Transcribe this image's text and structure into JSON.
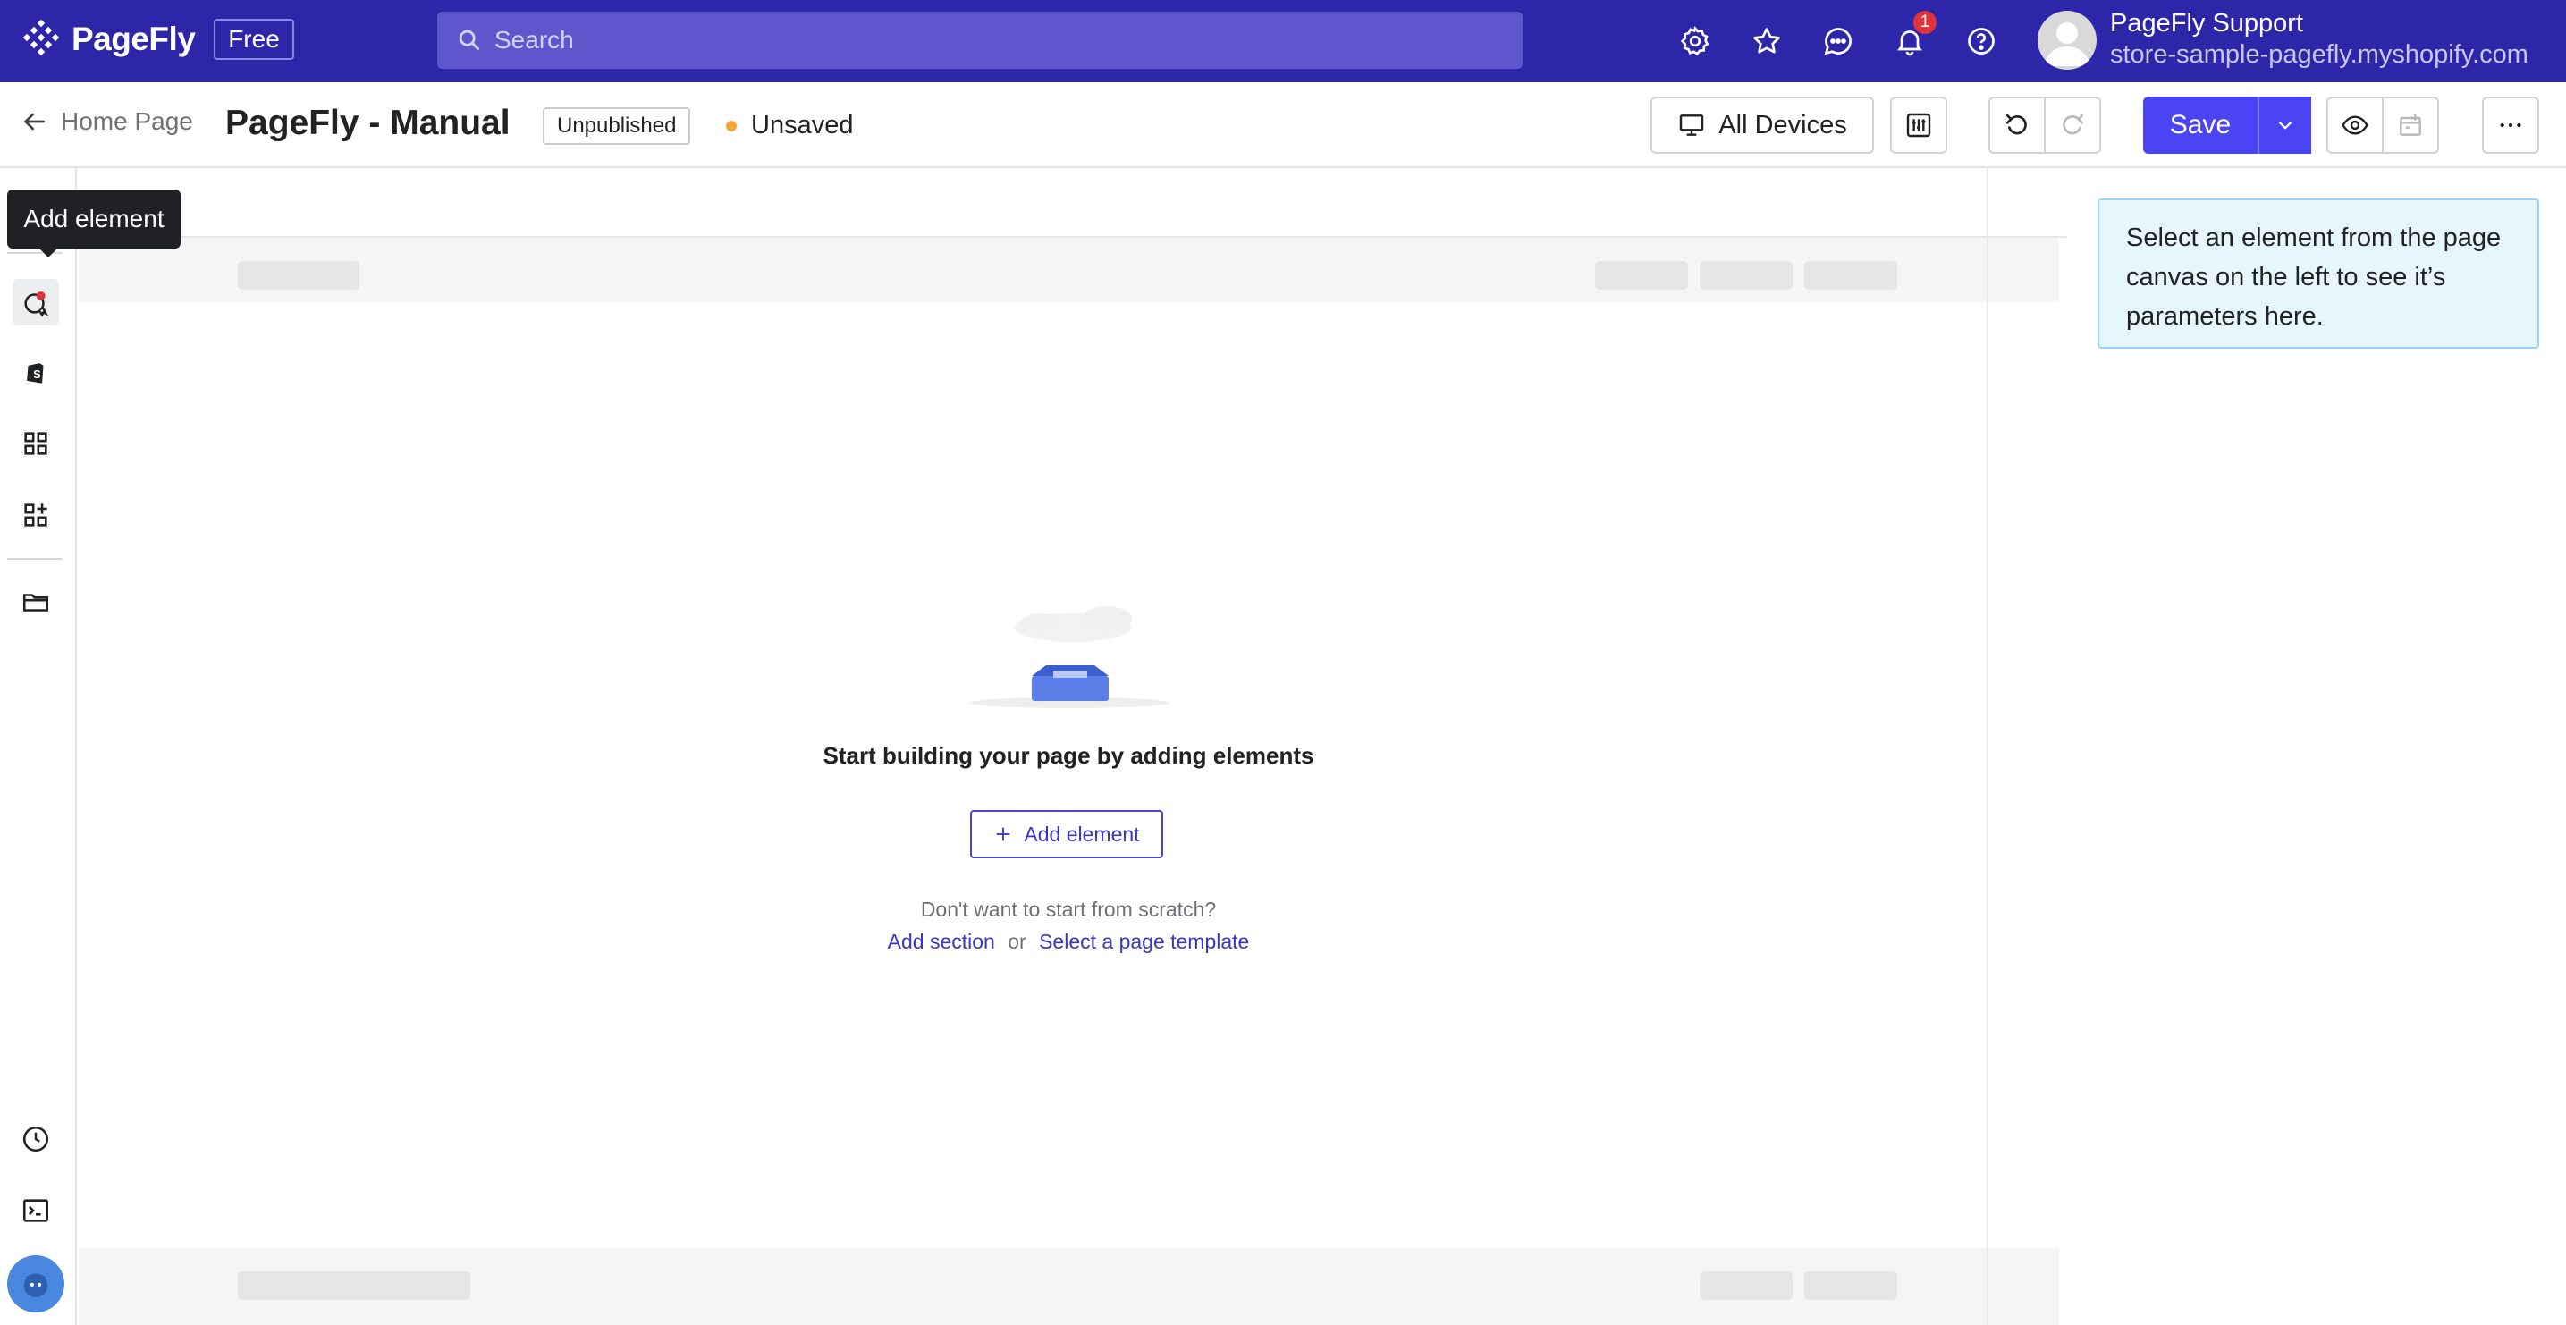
{
  "app": {
    "name": "PageFly",
    "plan": "Free"
  },
  "search": {
    "placeholder": "Search"
  },
  "topbar": {
    "notification_count": "1",
    "user_name": "PageFly Support",
    "store_domain": "store-sample-pagefly.myshopify.com"
  },
  "editor": {
    "back_label": "Home Page",
    "page_title": "PageFly - Manual",
    "publish_status": "Unpublished",
    "save_status": "Unsaved",
    "devices_label": "All Devices",
    "save_label": "Save"
  },
  "sidebar": {
    "tooltip": "Add element"
  },
  "canvas": {
    "empty_title": "Start building your page by adding elements",
    "add_element_label": "Add element",
    "scratch_prompt": "Don't want to start from scratch?",
    "add_section_label": "Add section",
    "or_label": "or",
    "template_label": "Select a page template"
  },
  "inspector": {
    "hint": "Select an element from the page canvas on the left to see it’s parameters here."
  },
  "colors": {
    "topbar": "#2d26a8",
    "primary": "#4a44f2",
    "info_bg": "#e7f5fc",
    "unsaved_dot": "#f0a63a",
    "badge_red": "#e0343d"
  },
  "icons": [
    "pagefly-logo-icon",
    "search-icon",
    "settings-icon",
    "star-icon",
    "chat-icon",
    "bell-icon",
    "help-icon",
    "arrow-left-icon",
    "desktop-icon",
    "sliders-icon",
    "undo-icon",
    "redo-icon",
    "chevron-down-icon",
    "eye-icon",
    "publish-icon",
    "more-icon",
    "add-element-icon",
    "shopify-icon",
    "grid-icon",
    "grid-plus-icon",
    "folder-icon",
    "clock-icon",
    "terminal-icon",
    "chat-bubble-icon",
    "plus-icon"
  ]
}
